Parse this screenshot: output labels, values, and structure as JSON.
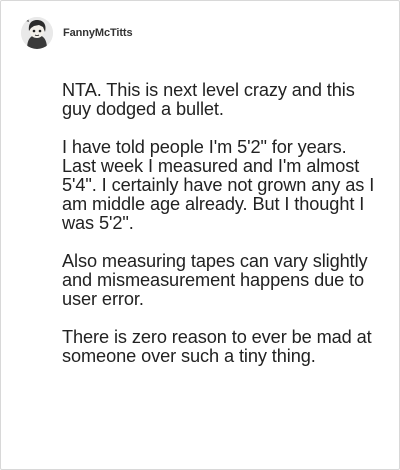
{
  "post": {
    "author": {
      "username": "FannyMcTitts",
      "avatar_icon": "cartoon-avatar-icon"
    },
    "paragraphs": [
      "NTA. This is next level crazy and this guy dodged a bullet.",
      "I have told people I'm 5'2\" for years. Last week I measured and I'm almost 5'4\". I certainly have not grown any as I am middle age already. But I thought I was 5'2\".",
      "Also measuring tapes can vary slightly and mismeasurement happens due to user error.",
      "There is zero reason to ever be mad at someone over such a tiny thing."
    ]
  }
}
